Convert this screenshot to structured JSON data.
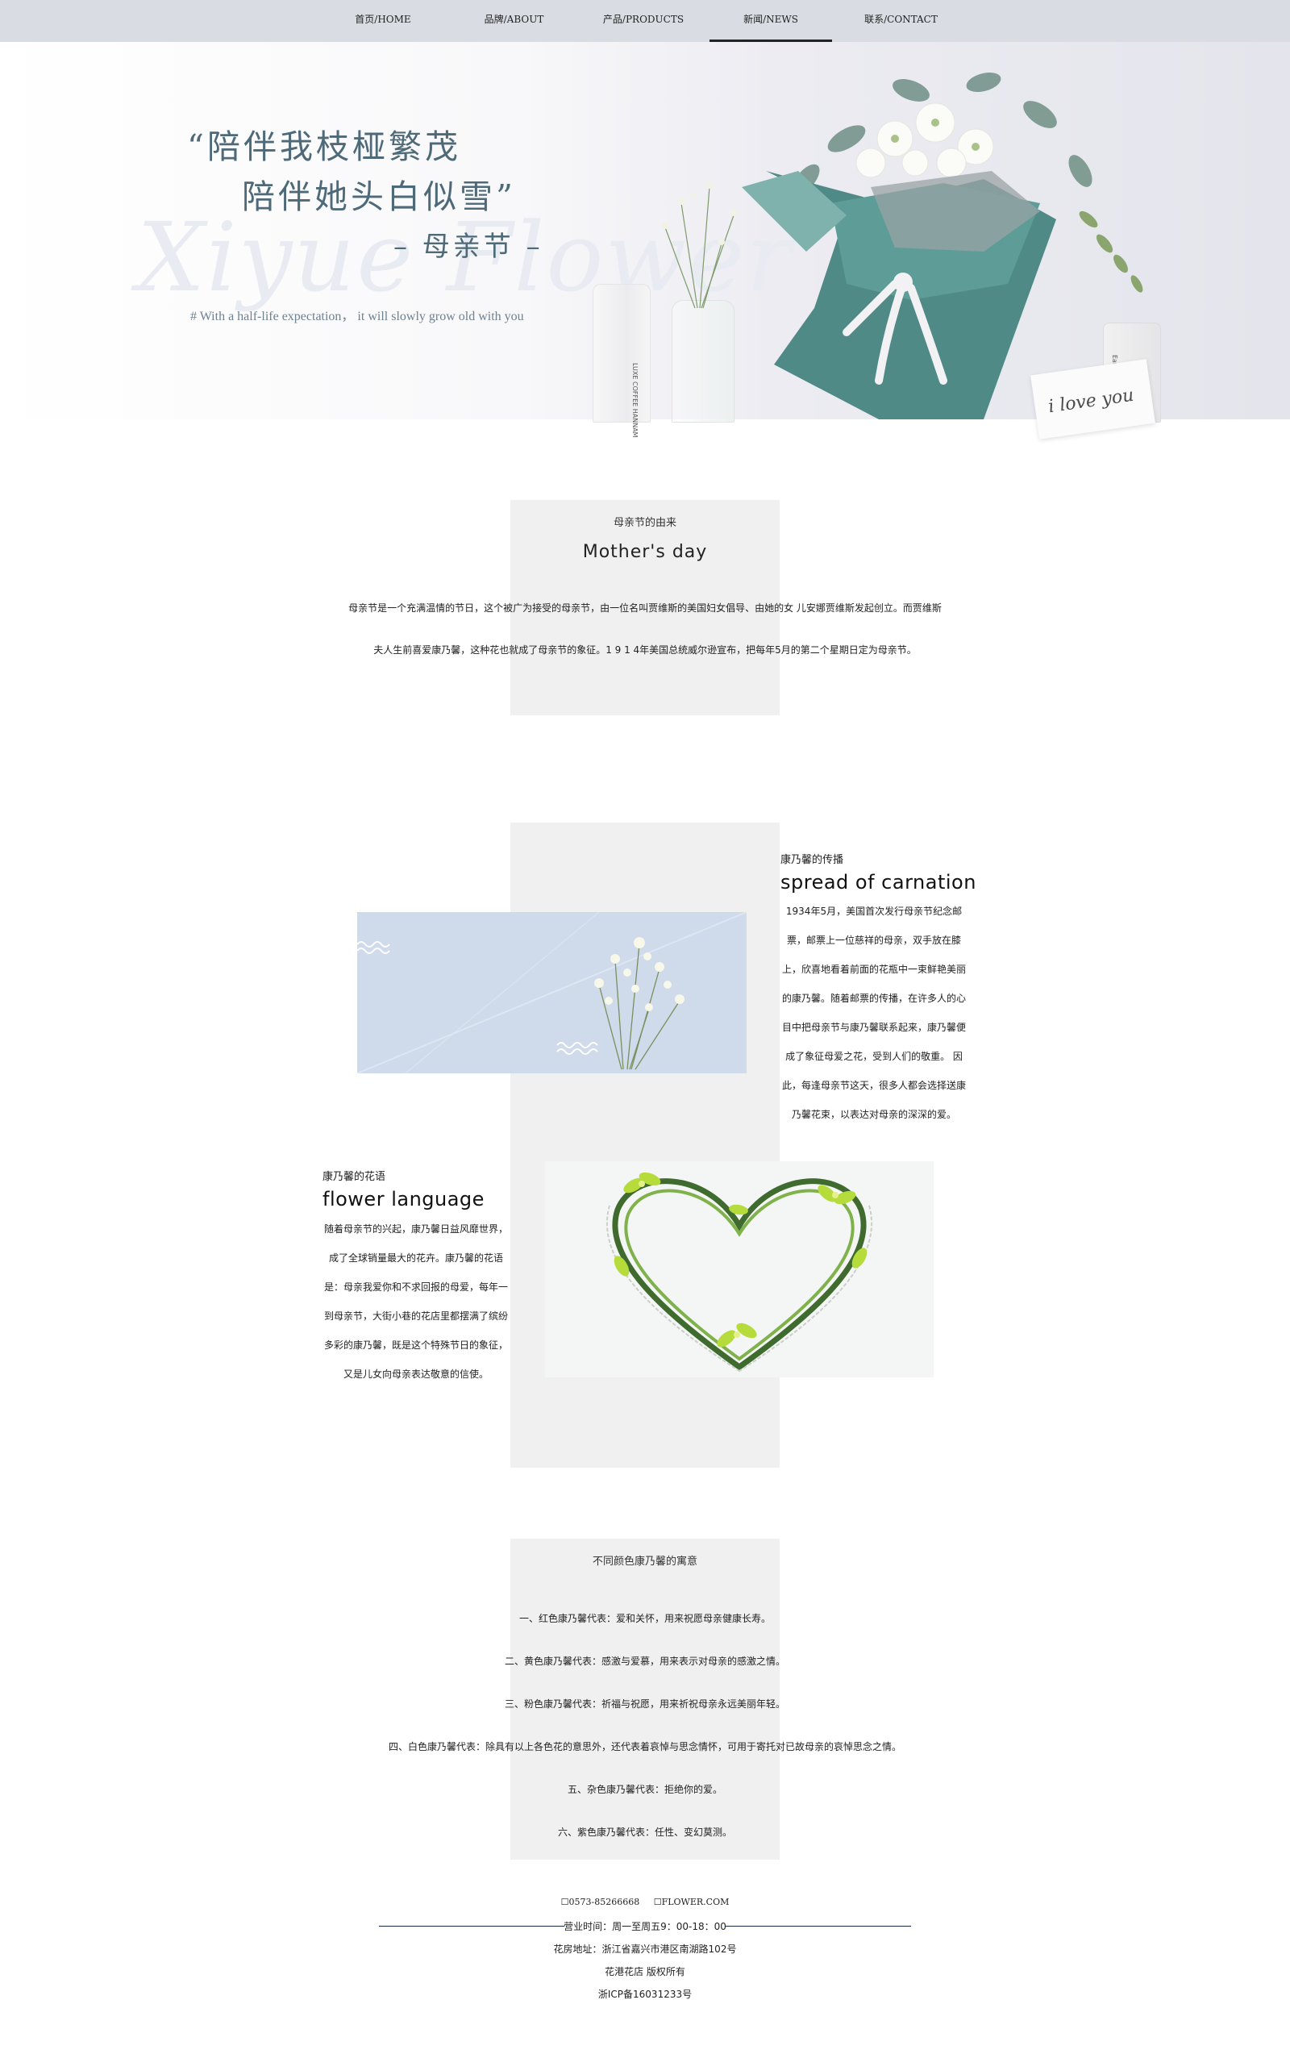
{
  "nav": {
    "items": [
      {
        "label": "首页/HOME"
      },
      {
        "label": "品牌/ABOUT"
      },
      {
        "label": "产品/PRODUCTS"
      },
      {
        "label": "新闻/NEWS"
      },
      {
        "label": "联系/CONTACT"
      }
    ],
    "active_index": 3
  },
  "hero": {
    "quote_line1": "“陪伴我枝桠繁茂",
    "quote_line2": "陪伴她头白似雪”",
    "quote_line3": "– 母亲节 –",
    "subtitle": "# With a half-life expectation，  it will slowly grow old with you",
    "script_watermark": "Xiyue Flower",
    "vase_label": "LUXE COFFEE HANNAM",
    "bottle_label": "Eat",
    "card_text": "i love you",
    "accent_color": "#4e6a78"
  },
  "section1": {
    "small_title": "母亲节的由来",
    "title": "Mother's day",
    "lines": [
      "母亲节是一个充满温情的节日，这个被广为接受的母亲节，由一位名叫贾维斯的美国妇女倡导、由她的女  儿安娜贾维斯发起创立。而贾维斯",
      "夫人生前喜爱康乃馨，这种花也就成了母亲节的象征。1 9 1 4年美国总统威尔逊宣布，把每年5月的第二个星期日定为母亲节。"
    ]
  },
  "section2": {
    "spread": {
      "small_title": "康乃馨的传播",
      "title": "spread of carnation",
      "lines": [
        "1934年5月，美国首次发行母亲节纪念邮",
        "票，邮票上一位慈祥的母亲，双手放在膝",
        "上，欣喜地看着前面的花瓶中一束鲜艳美丽",
        "的康乃馨。随着邮票的传播，在许多人的心",
        "目中把母亲节与康乃馨联系起来，康乃馨便",
        "成了象征母爱之花，受到人们的敬重。 因",
        "此，每逢母亲节这天，很多人都会选择送康",
        "乃馨花束，以表达对母亲的深深的爱。"
      ]
    },
    "language": {
      "small_title": "康乃馨的花语",
      "title": "flower language",
      "lines": [
        "随着母亲节的兴起，康乃馨日益风靡世界，",
        "成了全球销量最大的花卉。康乃馨的花语",
        "是：母亲我爱你和不求回报的母爱，每年一",
        "到母亲节，大街小巷的花店里都摆满了缤纷",
        "多彩的康乃馨，既是这个特殊节日的象征，",
        "又是儿女向母亲表达敬意的信使。"
      ]
    }
  },
  "section3": {
    "title": "不同颜色康乃馨的寓意",
    "items": [
      "一、红色康乃馨代表：爱和关怀，用来祝愿母亲健康长寿。",
      "二、黄色康乃馨代表：感激与爱慕，用来表示对母亲的感激之情。",
      "三、粉色康乃馨代表：祈福与祝愿，用来祈祝母亲永远美丽年轻。",
      "四、白色康乃馨代表：除具有以上各色花的意思外，还代表着哀悼与思念情怀，可用于寄托对已故母亲的哀悼思念之情。",
      "五、杂色康乃馨代表：拒绝你的爱。",
      "六、紫色康乃馨代表：任性、变幻莫测。"
    ]
  },
  "footer": {
    "phone_icon": "phone-icon",
    "phone": "0573-85266668",
    "web_icon": "globe-icon",
    "website": "FLOWER.COM",
    "hours": "营业时间：周一至周五9：00-18：00",
    "address": "花房地址：浙江省嘉兴市港区南湖路102号",
    "copyright": "花港花店 版权所有",
    "icp": "浙ICP备16031233号"
  }
}
